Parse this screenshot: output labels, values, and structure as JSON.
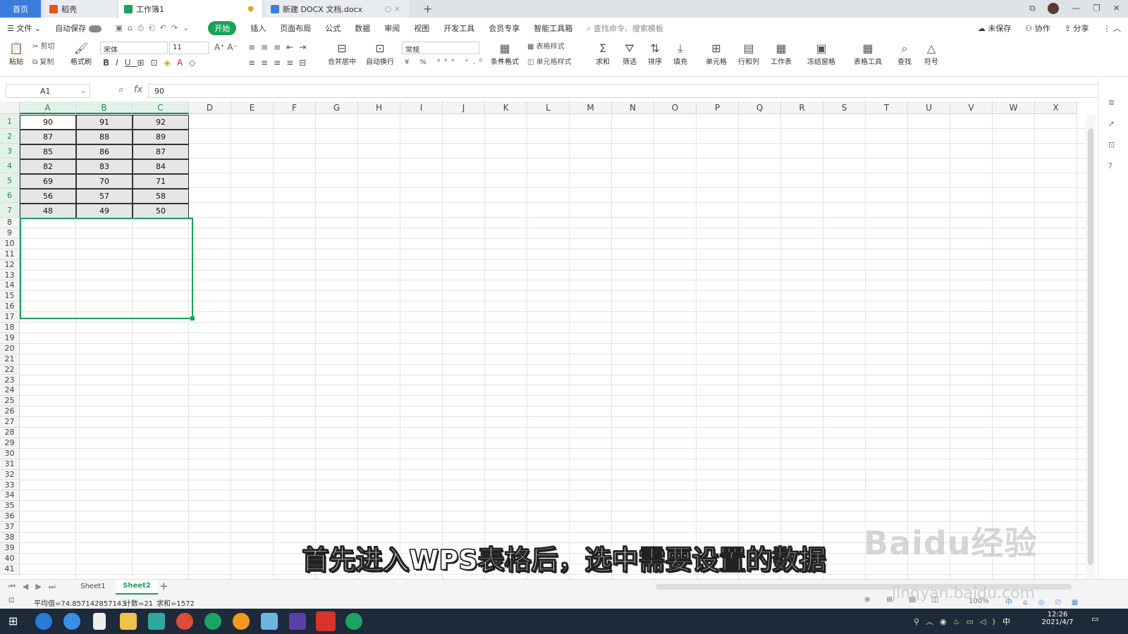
{
  "tabs": {
    "home": "首页",
    "daoke": "稻壳",
    "book": "工作簿1",
    "doc": "新建 DOCX 文档.docx",
    "plus": "+"
  },
  "menu": {
    "file": "文件",
    "autosave": "自动保存",
    "items": [
      "开始",
      "插入",
      "页面布局",
      "公式",
      "数据",
      "审阅",
      "视图",
      "开发工具",
      "会员专享",
      "智能工具箱"
    ],
    "search_placeholder": "查找命令、搜索模板",
    "unsaved": "未保存",
    "collab": "协作",
    "share": "分享"
  },
  "ribbon": {
    "paste": "粘贴",
    "cut": "剪切",
    "copy": "复制",
    "format_painter": "格式刷",
    "font_name": "宋体",
    "font_size": "11",
    "merge_center": "合并居中",
    "wrap": "自动换行",
    "number_format": "常规",
    "cond_format": "条件格式",
    "table_style": "表格样式",
    "cell_style": "单元格样式",
    "sum": "求和",
    "filter": "筛选",
    "sort": "排序",
    "fill": "填充",
    "cell": "单元格",
    "row_col": "行和列",
    "worksheet": "工作表",
    "freeze": "冻结窗格",
    "table_tools": "表格工具",
    "find": "查找",
    "symbol": "符号"
  },
  "formula": {
    "name_box": "A1",
    "fx": "fx",
    "value": "90"
  },
  "grid": {
    "columns": [
      "A",
      "B",
      "C",
      "D",
      "E",
      "F",
      "G",
      "H",
      "I",
      "J",
      "K",
      "L",
      "M",
      "N",
      "O",
      "P",
      "Q",
      "R",
      "S",
      "T",
      "U",
      "V",
      "W",
      "X"
    ],
    "rows": [
      "1",
      "2",
      "3",
      "4",
      "5",
      "6",
      "7",
      "8",
      "9",
      "10",
      "11",
      "12",
      "13",
      "14",
      "15",
      "16",
      "17",
      "18",
      "19",
      "20",
      "21",
      "22",
      "23",
      "24",
      "25",
      "26",
      "27",
      "28",
      "29",
      "30",
      "31",
      "32",
      "33",
      "34",
      "35",
      "36",
      "37",
      "38",
      "39",
      "40",
      "41"
    ],
    "data": [
      [
        "90",
        "91",
        "92"
      ],
      [
        "87",
        "88",
        "89"
      ],
      [
        "85",
        "86",
        "87"
      ],
      [
        "82",
        "83",
        "84"
      ],
      [
        "69",
        "70",
        "71"
      ],
      [
        "56",
        "57",
        "58"
      ],
      [
        "48",
        "49",
        "50"
      ]
    ]
  },
  "sheets": {
    "sheet1": "Sheet1",
    "sheet2": "Sheet2",
    "add": "+"
  },
  "status": {
    "average": "平均值=74.857142857143",
    "count": "计数=21",
    "sum": "求和=1572",
    "zoom": "100%"
  },
  "subtitle": "首先进入WPS表格后，选中需要设置的数据",
  "watermark": "Baidu经验",
  "watermark_url": "jingyan.baidu.com",
  "clock": {
    "time": "12:26",
    "date": "2021/4/7",
    "ime": "中"
  }
}
